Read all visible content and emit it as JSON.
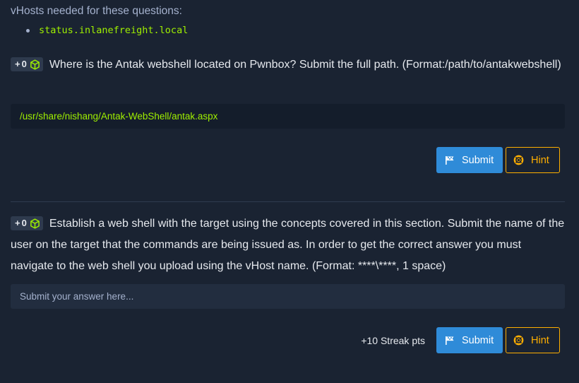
{
  "vhosts": {
    "heading": "vHosts needed for these questions:",
    "items": [
      "status.inlanefreight.local"
    ]
  },
  "questions": [
    {
      "badge_plus": "+",
      "badge_points": "0",
      "text": "Where is the Antak webshell located on Pwnbox? Submit the full path. (Format:/path/to/antakwebshell)",
      "answer_value": "/usr/share/nishang/Antak-WebShell/antak.aspx",
      "answer_placeholder": "",
      "submit_label": "Submit",
      "hint_label": "Hint",
      "streak_label": ""
    },
    {
      "badge_plus": "+",
      "badge_points": "0",
      "text": "Establish a web shell with the target using the concepts covered in this section. Submit the name of the user on the target that the commands are being issued as. In order to get the correct answer you must navigate to the web shell you upload using the vHost name. (Format: ****\\****, 1 space)",
      "answer_value": "",
      "answer_placeholder": "Submit your answer here...",
      "submit_label": "Submit",
      "hint_label": "Hint",
      "streak_label": "+10 Streak pts"
    }
  ],
  "icons": {
    "badge": "cube-icon",
    "submit": "flag-icon",
    "hint": "lifebuoy-icon"
  },
  "colors": {
    "background": "#1a2332",
    "accent_green": "#9fef00",
    "submit_blue": "#2f8bd8",
    "hint_orange": "#ffaf00",
    "muted_text": "#a4b1cd"
  }
}
